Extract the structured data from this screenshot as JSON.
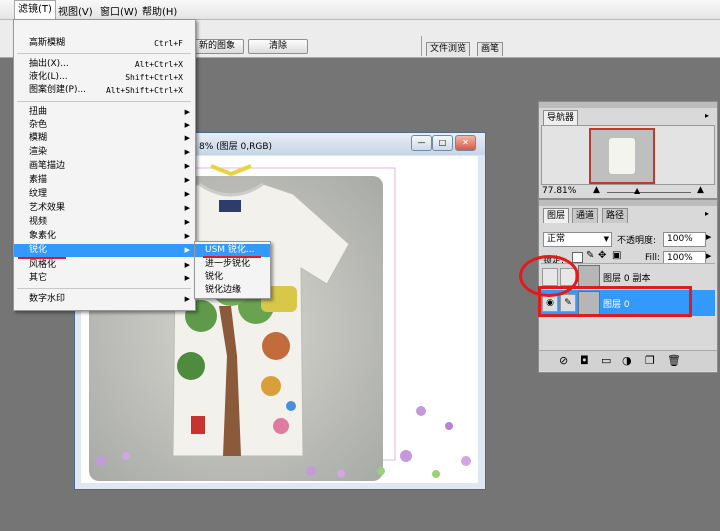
{
  "menubar": {
    "items": [
      "滤镜(T)",
      "视图(V)",
      "窗口(W)",
      "帮助(H)"
    ]
  },
  "options_bar": {
    "button_image_label": "新的图象",
    "button_clear_label": "清除",
    "tab_file_browser": "文件浏览",
    "tab_brushes": "画笔"
  },
  "filter_menu": {
    "items": [
      {
        "label": "高斯模糊",
        "shortcut": "Ctrl+F"
      },
      {
        "label": "抽出(X)...",
        "shortcut": "Alt+Ctrl+X"
      },
      {
        "label": "液化(L)...",
        "shortcut": "Shift+Ctrl+X"
      },
      {
        "label": "图案创建(P)...",
        "shortcut": "Alt+Shift+Ctrl+X"
      },
      {
        "label": "扭曲"
      },
      {
        "label": "杂色"
      },
      {
        "label": "模糊"
      },
      {
        "label": "渲染"
      },
      {
        "label": "画笔描边"
      },
      {
        "label": "素描"
      },
      {
        "label": "纹理"
      },
      {
        "label": "艺术效果"
      },
      {
        "label": "视频"
      },
      {
        "label": "象素化"
      },
      {
        "label": "锐化"
      },
      {
        "label": "风格化"
      },
      {
        "label": "其它"
      },
      {
        "label": "数字水印"
      }
    ]
  },
  "sharpen_submenu": {
    "items": [
      "USM 锐化...",
      "进一步锐化",
      "锐化",
      "锐化边缘"
    ]
  },
  "document": {
    "title": "8% (图层 0,RGB)",
    "min": "—",
    "max": "□",
    "close": "✕"
  },
  "navigator": {
    "tab": "导航器",
    "zoom": "77.81%"
  },
  "layers_panel": {
    "tabs": [
      "图层",
      "通道",
      "路径"
    ],
    "blend_mode": "正常",
    "opacity_label": "不透明度:",
    "opacity_value": "100%",
    "lock_label": "锁定:",
    "fill_label": "Fill:",
    "fill_value": "100%",
    "layers": [
      {
        "name": "图层 0 副本",
        "visible": false,
        "selected": false
      },
      {
        "name": "图层 0",
        "visible": true,
        "selected": true
      }
    ]
  },
  "colors": {
    "highlight": "#3399ff",
    "annotation_red": "#e01b1b"
  }
}
